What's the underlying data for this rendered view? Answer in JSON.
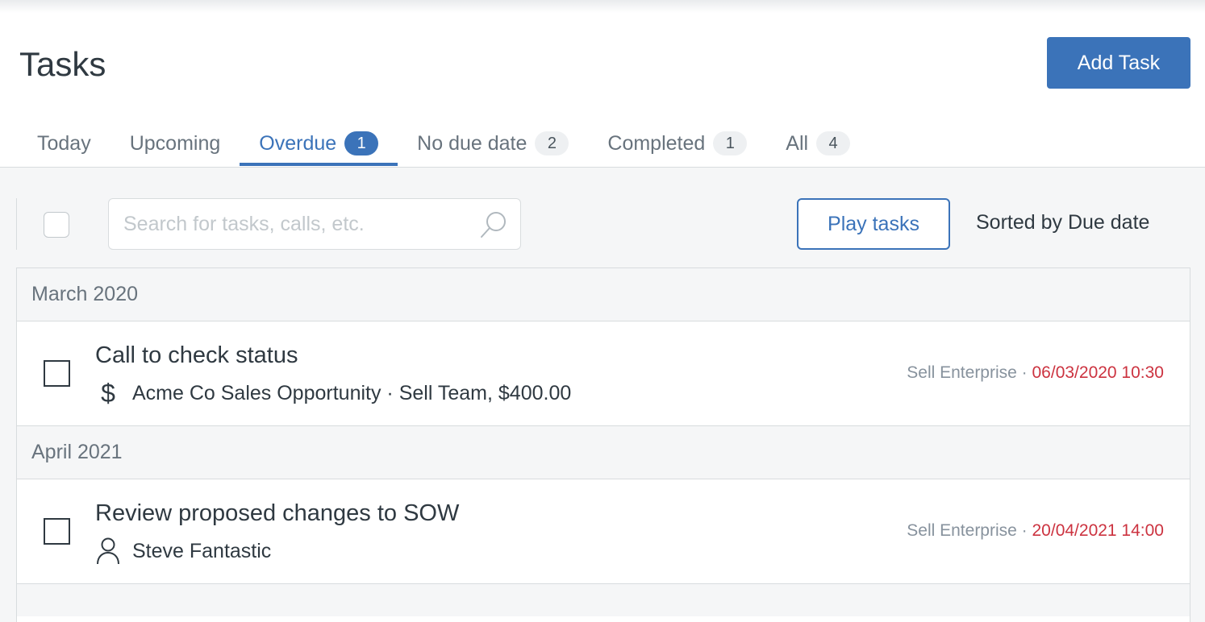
{
  "header": {
    "title": "Tasks",
    "add_button": "Add Task"
  },
  "tabs": [
    {
      "label": "Today",
      "count": null
    },
    {
      "label": "Upcoming",
      "count": null
    },
    {
      "label": "Overdue",
      "count": "1",
      "active": true
    },
    {
      "label": "No due date",
      "count": "2"
    },
    {
      "label": "Completed",
      "count": "1"
    },
    {
      "label": "All",
      "count": "4"
    }
  ],
  "toolbar": {
    "search_placeholder": "Search for tasks, calls, etc.",
    "play_button": "Play tasks",
    "sort_label": "Sorted by Due date"
  },
  "groups": [
    {
      "header": "March 2020",
      "task": {
        "title": "Call to check status",
        "icon": "dollar-icon",
        "subtitle": "Acme Co Sales Opportunity · Sell Team, $400.00",
        "source": "Sell Enterprise · ",
        "due": "06/03/2020 10:30"
      }
    },
    {
      "header": "April 2021",
      "task": {
        "title": "Review proposed changes to SOW",
        "icon": "person-icon",
        "subtitle": "Steve Fantastic",
        "source": "Sell Enterprise · ",
        "due": "20/04/2021 14:00"
      }
    }
  ],
  "colors": {
    "accent": "#3b73b9",
    "overdue": "#cc3340",
    "muted": "#68737d"
  }
}
